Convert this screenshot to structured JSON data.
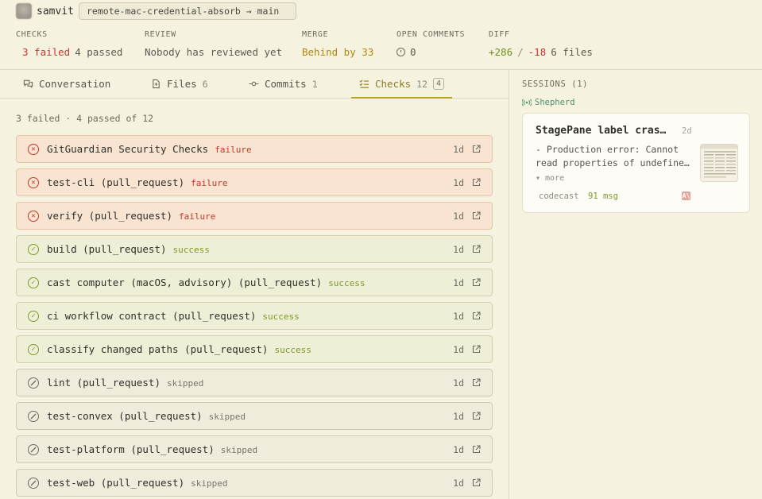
{
  "header": {
    "author": "samvit",
    "branch": "remote-mac-credential-absorb → main",
    "stats": {
      "checks": {
        "label": "CHECKS",
        "failed": "3 failed",
        "passed": "4 passed"
      },
      "review": {
        "label": "REVIEW",
        "value": "Nobody has reviewed yet"
      },
      "merge": {
        "label": "MERGE",
        "value": "Behind by 33"
      },
      "open_comments": {
        "label": "OPEN COMMENTS",
        "value": "0"
      },
      "diff": {
        "label": "DIFF",
        "additions": "+286",
        "separator": "/",
        "deletions": "-18",
        "files": "6 files"
      }
    }
  },
  "tabs": [
    {
      "label": "Conversation",
      "count": "",
      "icon": "chat-icon"
    },
    {
      "label": "Files",
      "count": "6",
      "icon": "file-icon"
    },
    {
      "label": "Commits",
      "count": "1",
      "icon": "commit-icon"
    },
    {
      "label": "Checks",
      "count": "12",
      "badge": "4",
      "icon": "checklist-icon",
      "active": true
    }
  ],
  "checks_summary": "3 failed · 4 passed of 12",
  "checks": [
    {
      "name": "GitGuardian Security Checks",
      "status": "failure",
      "age": "1d"
    },
    {
      "name": "test-cli (pull_request)",
      "status": "failure",
      "age": "1d"
    },
    {
      "name": "verify (pull_request)",
      "status": "failure",
      "age": "1d"
    },
    {
      "name": "build (pull_request)",
      "status": "success",
      "age": "1d"
    },
    {
      "name": "cast computer (macOS, advisory) (pull_request)",
      "status": "success",
      "age": "1d"
    },
    {
      "name": "ci workflow contract (pull_request)",
      "status": "success",
      "age": "1d"
    },
    {
      "name": "classify changed paths (pull_request)",
      "status": "success",
      "age": "1d"
    },
    {
      "name": "lint (pull_request)",
      "status": "skipped",
      "age": "1d"
    },
    {
      "name": "test-convex (pull_request)",
      "status": "skipped",
      "age": "1d"
    },
    {
      "name": "test-platform (pull_request)",
      "status": "skipped",
      "age": "1d"
    },
    {
      "name": "test-web (pull_request)",
      "status": "skipped",
      "age": "1d"
    }
  ],
  "sessions": {
    "title": "SESSIONS (1)",
    "agent": "Shepherd",
    "card": {
      "title": "StagePane label cras…",
      "age": "2d",
      "description_line1": "- Production error: Cannot",
      "description_line2": "read properties of undefine…",
      "more": "▾ more",
      "source": "codecast",
      "messages": "91 msg"
    }
  },
  "colors": {
    "background": "#f6f2e0",
    "failure": "#c0392b",
    "success": "#7d9a2a",
    "merge_behind": "#b0870e",
    "accent_tab": "#b3a430"
  }
}
